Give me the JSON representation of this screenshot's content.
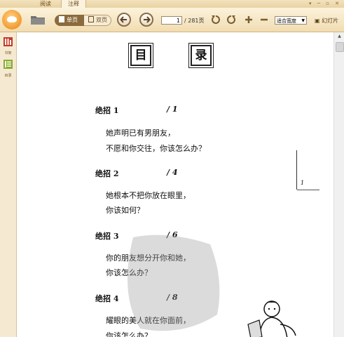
{
  "tabs": [
    {
      "label": "阅读"
    },
    {
      "label": "注释"
    }
  ],
  "toolbar": {
    "single_page": "单页",
    "double_page": "双页",
    "current_page": "1",
    "total_pages": "/ 281页",
    "fit_option": "适合宽度",
    "slideshow": "幻灯片"
  },
  "sidebar": {
    "items": [
      {
        "label": "书架",
        "icon": "bookshelf-icon"
      },
      {
        "label": "目录",
        "icon": "toc-icon"
      }
    ]
  },
  "document": {
    "title_chars": [
      "目",
      "录"
    ],
    "entries": [
      {
        "title": "绝招 1",
        "page": "/ 1",
        "lines": [
          "她声明已有男朋友，",
          "不愿和你交往，你该怎么办？"
        ]
      },
      {
        "title": "绝招 2",
        "page": "/ 4",
        "lines": [
          "她根本不把你放在眼里，",
          "你该如何？"
        ]
      },
      {
        "title": "绝招 3",
        "page": "/ 6",
        "lines": [
          "你的朋友想分开你和她，",
          "你该怎么办？"
        ]
      },
      {
        "title": "绝招 4",
        "page": "/ 8",
        "lines": [
          "耀眼的美人就在你面前，",
          "你该怎么办？"
        ]
      }
    ],
    "side_number": "1"
  },
  "colors": {
    "toolbar": "#f0dcb1",
    "accent": "#8b6a3d",
    "logo": "#f29a2e"
  }
}
